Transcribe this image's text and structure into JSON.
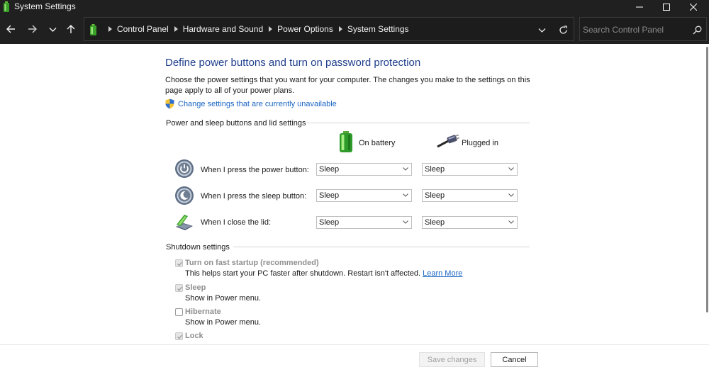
{
  "window": {
    "title": "System Settings"
  },
  "nav": {
    "breadcrumbs": [
      "Control Panel",
      "Hardware and Sound",
      "Power Options",
      "System Settings"
    ],
    "search_placeholder": "Search Control Panel"
  },
  "page": {
    "title": "Define power buttons and turn on password protection",
    "description": "Choose the power settings that you want for your computer. The changes you make to the settings on this page apply to all of your power plans.",
    "change_link": "Change settings that are currently unavailable"
  },
  "power_group": {
    "heading": "Power and sleep buttons and lid settings",
    "col_battery": "On battery",
    "col_plugged": "Plugged in",
    "rows": [
      {
        "label": "When I press the power button:",
        "battery": "Sleep",
        "plugged": "Sleep"
      },
      {
        "label": "When I press the sleep button:",
        "battery": "Sleep",
        "plugged": "Sleep"
      },
      {
        "label": "When I close the lid:",
        "battery": "Sleep",
        "plugged": "Sleep"
      }
    ]
  },
  "shutdown_group": {
    "heading": "Shutdown settings",
    "items": [
      {
        "label": "Turn on fast startup (recommended)",
        "checked": true,
        "desc": "This helps start your PC faster after shutdown. Restart isn't affected.",
        "link": "Learn More"
      },
      {
        "label": "Sleep",
        "checked": true,
        "desc": "Show in Power menu."
      },
      {
        "label": "Hibernate",
        "checked": false,
        "desc": "Show in Power menu."
      },
      {
        "label": "Lock",
        "checked": true
      }
    ]
  },
  "footer": {
    "save": "Save changes",
    "cancel": "Cancel"
  },
  "colors": {
    "title_blue": "#1e3e8c",
    "link_blue": "#1a66c4",
    "chrome_dark": "#202020"
  },
  "icons": [
    "power-options-icon",
    "back-arrow-icon",
    "forward-arrow-icon",
    "chevron-down-icon",
    "up-arrow-icon",
    "refresh-icon",
    "search-icon",
    "uac-shield-icon",
    "battery-icon",
    "power-plug-icon",
    "power-button-icon",
    "sleep-button-icon",
    "laptop-lid-icon",
    "checkmark-icon"
  ]
}
